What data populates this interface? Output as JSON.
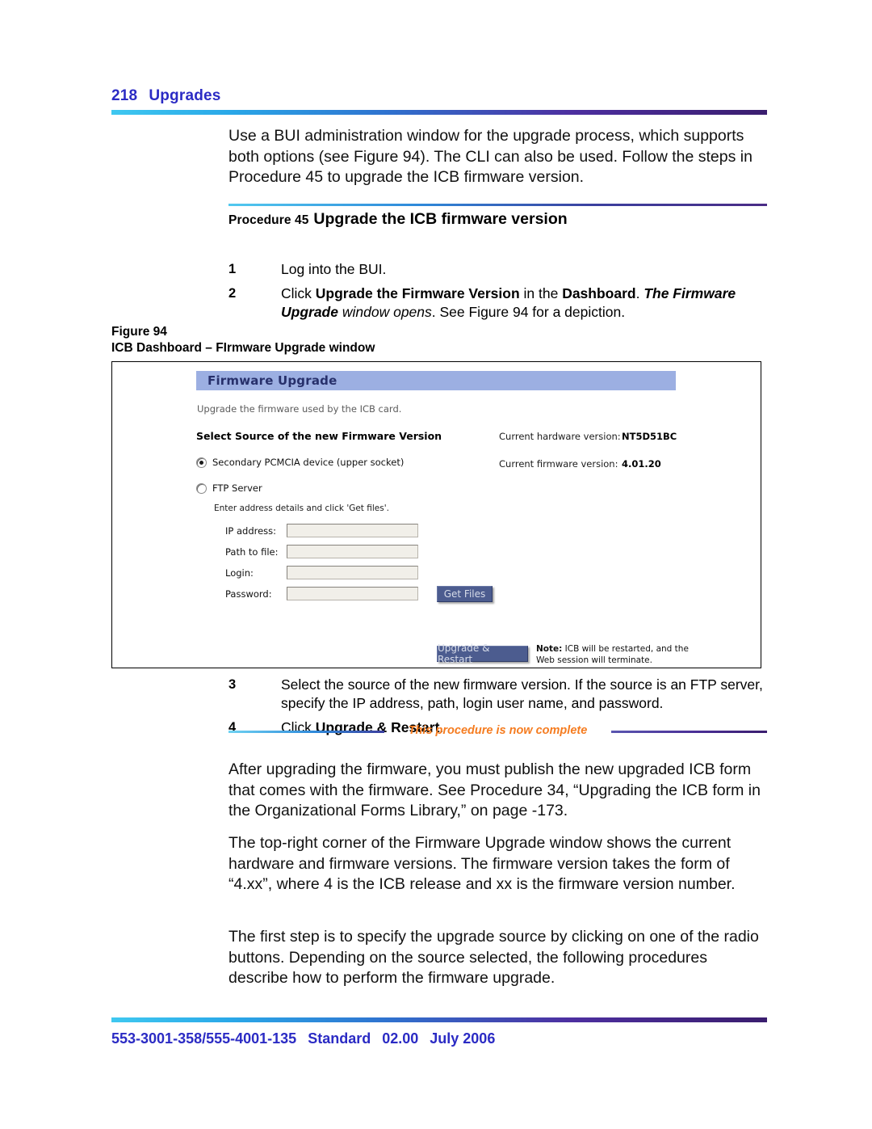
{
  "header": {
    "page_number": "218",
    "section_title": "Upgrades"
  },
  "intro_paragraph": "Use a BUI administration window for the upgrade process, which supports both options (see Figure 94). The CLI can also be used. Follow the steps in Procedure 45 to upgrade the ICB firmware version.",
  "procedure": {
    "label": "Procedure 45",
    "name": "Upgrade the ICB firmware version",
    "steps": [
      {
        "number": "1",
        "text": "Log into the BUI."
      },
      {
        "number": "2",
        "text": "Click Upgrade the Firmware Version in the Dashboard. The Firmware Upgrade window opens. See Figure 94 for a depiction."
      },
      {
        "number": "3",
        "text": "Select the source of the new firmware version. If the source is an FTP server, specify the IP address, path, login user name, and password."
      },
      {
        "number": "4",
        "text": "Click Upgrade & Restart."
      }
    ],
    "complete_marker": "This procedure is now complete"
  },
  "figure": {
    "number": "Figure 94",
    "caption": "ICB Dashboard – FIrmware Upgrade window"
  },
  "app_window": {
    "title": "Firmware Upgrade",
    "subtitle": "Upgrade the firmware used by the ICB card.",
    "section_heading": "Select Source of the new Firmware Version",
    "source_options": [
      {
        "label": "Secondary PCMCIA device (upper socket)",
        "selected": true
      },
      {
        "label": "FTP Server",
        "selected": false
      }
    ],
    "ftp_hint": "Enter address details and click 'Get files'.",
    "fields": [
      {
        "label": "IP address:",
        "value": ""
      },
      {
        "label": "Path to file:",
        "value": ""
      },
      {
        "label": "Login:",
        "value": ""
      },
      {
        "label": "Password:",
        "value": ""
      }
    ],
    "buttons": {
      "get_files": "Get Files",
      "upgrade_restart": "Upgrade & Restart"
    },
    "note_label": "Note:",
    "note_text": " ICB will be restarted, and the Web session will terminate.",
    "versions": [
      {
        "label": "Current hardware version:",
        "value": "NT5D51BC"
      },
      {
        "label": "Current firmware version:",
        "value": "4.01.20"
      }
    ],
    "colors": {
      "titlebar": "#9cafe2",
      "titlebar_text": "#27306b",
      "button": "#4c5c8f",
      "button_text": "#d7dce9",
      "input_bg": "#f1efe9"
    }
  },
  "closing_paragraphs": [
    "After upgrading the firmware, you must publish the new upgraded ICB form that comes with the firmware. See Procedure 34,  “Upgrading the ICB form in the Organizational Forms Library,” on page -173.",
    "The top-right corner of the Firmware Upgrade window shows the current hardware and firmware versions. The firmware version takes the form of “4.xx”, where 4 is the ICB release and xx is the firmware version number.",
    "The first step is to specify the upgrade source by clicking on one of the radio buttons. Depending on the source selected, the following procedures describe how to perform the firmware upgrade."
  ],
  "footer": {
    "doc_number": "553-3001-358/555-4001-135",
    "status": "Standard",
    "version": "02.00",
    "date": "July 2006"
  },
  "accent_colors": {
    "heading_blue": "#2b2bc4",
    "complete_orange": "#f57c20"
  }
}
